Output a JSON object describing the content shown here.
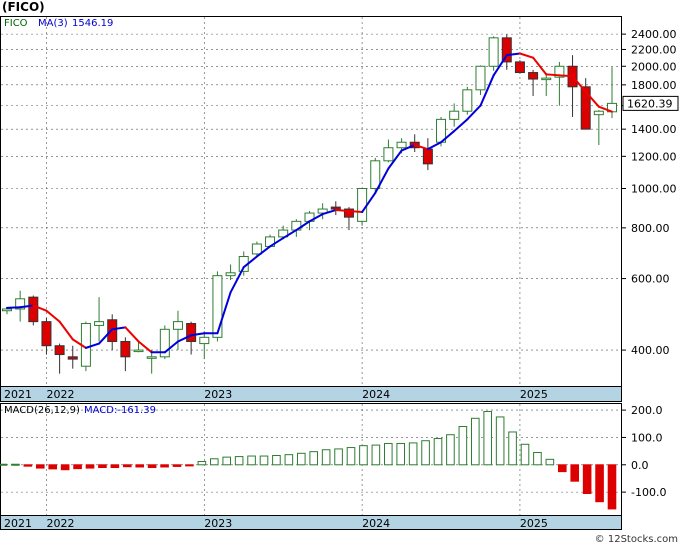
{
  "ticker_label": "(FICO)",
  "credit": "© 12Stocks.com",
  "price_panel": {
    "legend_series": "FICO",
    "legend_ma": "MA(3)",
    "legend_ma_value": "1546.19",
    "last_price_label": "1620.39",
    "last_price": 1620.39,
    "y_ticks": [
      400,
      600,
      800,
      1000,
      1200,
      1400,
      1600,
      1800,
      2000,
      2200,
      2400
    ],
    "y_tick_labels": [
      "400.00",
      "600.00",
      "800.00",
      "1000.00",
      "1200.00",
      "1400.00",
      "1600.00",
      "1800.00",
      "2000.00",
      "2200.00",
      "2400.00"
    ]
  },
  "macd_panel": {
    "legend_label": "MACD(26,12,9)",
    "legend_value": "MACD:-161.39",
    "y_ticks": [
      -100,
      0,
      100,
      200
    ],
    "y_tick_labels": [
      "-100.0",
      "0.0",
      "100.0",
      "200.0"
    ]
  },
  "x_axis": {
    "year_labels": [
      "2021",
      "2022",
      "2023",
      "2024",
      "2025"
    ]
  },
  "colors": {
    "up": "#2e7d32",
    "down": "#dd0000",
    "ma_rising": "#0000dd",
    "ma_falling": "#ee0000",
    "axis_band": "#b4d4e4",
    "grid": "#555555"
  },
  "chart_data": {
    "type": "candlestick",
    "title": "(FICO)",
    "scale": "log",
    "ylim": [
      330,
      2600
    ],
    "macd_ylim": [
      -180,
      215
    ],
    "months": [
      "2021-10",
      "2021-11",
      "2021-12",
      "2022-01",
      "2022-02",
      "2022-03",
      "2022-04",
      "2022-05",
      "2022-06",
      "2022-07",
      "2022-08",
      "2022-09",
      "2022-10",
      "2022-11",
      "2022-12",
      "2023-01",
      "2023-02",
      "2023-03",
      "2023-04",
      "2023-05",
      "2023-06",
      "2023-07",
      "2023-08",
      "2023-09",
      "2023-10",
      "2023-11",
      "2023-12",
      "2024-01",
      "2024-02",
      "2024-03",
      "2024-04",
      "2024-05",
      "2024-06",
      "2024-07",
      "2024-08",
      "2024-09",
      "2024-10",
      "2024-11",
      "2024-12",
      "2025-01",
      "2025-02",
      "2025-03",
      "2025-04",
      "2025-05",
      "2025-06",
      "2025-07",
      "2025-08"
    ],
    "open": [
      500,
      505,
      540,
      470,
      410,
      385,
      365,
      460,
      475,
      420,
      400,
      385,
      385,
      450,
      465,
      415,
      430,
      610,
      625,
      690,
      720,
      760,
      790,
      830,
      870,
      900,
      890,
      830,
      1000,
      1170,
      1260,
      1300,
      1250,
      1300,
      1480,
      1550,
      1750,
      2000,
      2350,
      2050,
      1930,
      1860,
      1880,
      2000,
      1780,
      1520,
      1545
    ],
    "high": [
      510,
      560,
      545,
      480,
      415,
      410,
      470,
      540,
      490,
      430,
      420,
      400,
      460,
      500,
      470,
      445,
      625,
      650,
      700,
      740,
      770,
      810,
      840,
      880,
      920,
      930,
      900,
      1000,
      1190,
      1320,
      1330,
      1360,
      1330,
      1500,
      1620,
      1780,
      2010,
      2370,
      2400,
      2070,
      1960,
      1900,
      2050,
      2130,
      1870,
      1560,
      1990
    ],
    "low": [
      490,
      470,
      460,
      390,
      350,
      360,
      355,
      420,
      400,
      355,
      395,
      350,
      380,
      400,
      390,
      380,
      420,
      595,
      610,
      680,
      720,
      750,
      760,
      790,
      840,
      860,
      790,
      810,
      980,
      1160,
      1220,
      1230,
      1110,
      1270,
      1420,
      1520,
      1700,
      1950,
      1960,
      1920,
      1690,
      1690,
      1600,
      1500,
      1420,
      1280,
      1490
    ],
    "close": [
      505,
      535,
      470,
      410,
      390,
      380,
      465,
      470,
      420,
      385,
      400,
      385,
      450,
      470,
      420,
      430,
      610,
      620,
      680,
      730,
      760,
      790,
      830,
      870,
      890,
      890,
      850,
      1000,
      1170,
      1260,
      1300,
      1260,
      1150,
      1480,
      1550,
      1750,
      2000,
      2350,
      2050,
      1930,
      1860,
      1870,
      2000,
      1780,
      1400,
      1550,
      1620.39
    ],
    "ma": [
      508,
      510,
      515,
      500,
      470,
      425,
      405,
      415,
      450,
      455,
      420,
      395,
      395,
      420,
      435,
      440,
      440,
      555,
      640,
      680,
      720,
      755,
      790,
      830,
      865,
      885,
      880,
      875,
      975,
      1120,
      1240,
      1280,
      1250,
      1300,
      1385,
      1480,
      1600,
      1900,
      2130,
      2150,
      2100,
      1910,
      1900,
      1890,
      1730,
      1590,
      1546.19
    ],
    "macd": [
      2,
      2,
      -5,
      -12,
      -15,
      -18,
      -14,
      -12,
      -10,
      -10,
      -7,
      -8,
      -10,
      -8,
      -6,
      -4,
      12,
      22,
      28,
      30,
      32,
      32,
      34,
      37,
      42,
      48,
      55,
      58,
      63,
      70,
      72,
      78,
      78,
      80,
      88,
      96,
      110,
      140,
      170,
      195,
      175,
      120,
      75,
      45,
      20,
      -25,
      -60,
      -105,
      -135,
      -161.39
    ]
  }
}
